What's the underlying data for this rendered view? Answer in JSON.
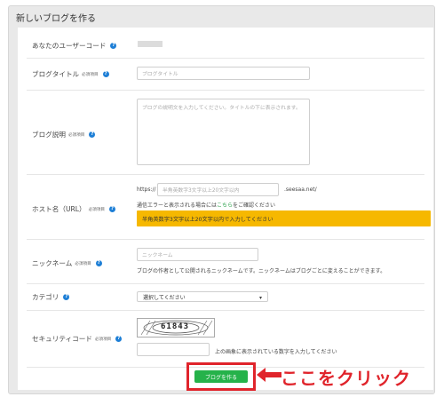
{
  "panel": {
    "title": "新しいブログを作る"
  },
  "form": {
    "user_code": {
      "label": "あなたのユーザーコード"
    },
    "blog_title": {
      "label": "ブログタイトル",
      "required": "必須項目",
      "placeholder": "ブログタイトル"
    },
    "blog_desc": {
      "label": "ブログ説明",
      "required": "必須項目",
      "placeholder": "ブログの説明文を入力してください。タイトルの下に表示されます。"
    },
    "host": {
      "label": "ホスト名（URL）",
      "required": "必須項目",
      "prefix": "https://",
      "placeholder": "半角英数字3文字以上20文字以内",
      "suffix": ".seesaa.net/",
      "hint_before": "通信エラーと表示される場合には",
      "hint_link": "こちら",
      "hint_after": "をご確認ください",
      "warning": "半角英数字3文字以上20文字以内で入力してください"
    },
    "nickname": {
      "label": "ニックネーム",
      "required": "必須項目",
      "placeholder": "ニックネーム",
      "hint": "ブログの作者として公開されるニックネームです。ニックネームはブログごとに変えることができます。"
    },
    "category": {
      "label": "カテゴリ",
      "selected": "選択してください"
    },
    "security": {
      "label": "セキュリティコード",
      "required": "必須項目",
      "captcha_text": "61843",
      "hint": "上の画象に表示されている数字を入力してください"
    },
    "help_glyph": "?"
  },
  "submit": {
    "label": "ブログを作る"
  },
  "annotation": {
    "text": "ここをクリック",
    "color": "#e0242b"
  },
  "colors": {
    "accent_green": "#25b24a",
    "warning": "#f6b800",
    "help_blue": "#1e7fd6"
  }
}
